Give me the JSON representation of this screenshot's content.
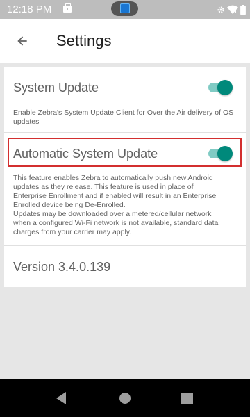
{
  "status_bar": {
    "time": "12:18 PM",
    "icons": [
      "briefcase-icon",
      "screen-app-icon",
      "settings-gear-icon",
      "wifi-icon",
      "battery-icon"
    ]
  },
  "toolbar": {
    "title": "Settings",
    "back_icon": "arrow-back-icon"
  },
  "preferences": {
    "system_update": {
      "title": "System Update",
      "summary": "Enable Zebra's System Update Client for Over the Air delivery of OS updates",
      "enabled": true
    },
    "automatic_update": {
      "title": "Automatic System Update",
      "summary_lines": [
        "This feature enables Zebra to automatically push new Android",
        "updates as they release. This feature is used in place of",
        "Enterprise Enrollment and if enabled will result in an Enterprise",
        "Enrolled device being De-Enrolled.",
        "Updates may be downloaded over a metered/cellular network",
        "when a configured Wi-Fi network is not available, standard data",
        "charges from your carrier may apply."
      ],
      "enabled": true,
      "highlighted": true
    },
    "version": "Version 3.4.0.139"
  },
  "nav_bar": {
    "buttons": [
      "nav-back-icon",
      "nav-home-icon",
      "nav-recents-icon"
    ]
  },
  "colors": {
    "accent": "#00897b",
    "accent_track": "#80cbc4",
    "highlight": "#d32f2f"
  }
}
